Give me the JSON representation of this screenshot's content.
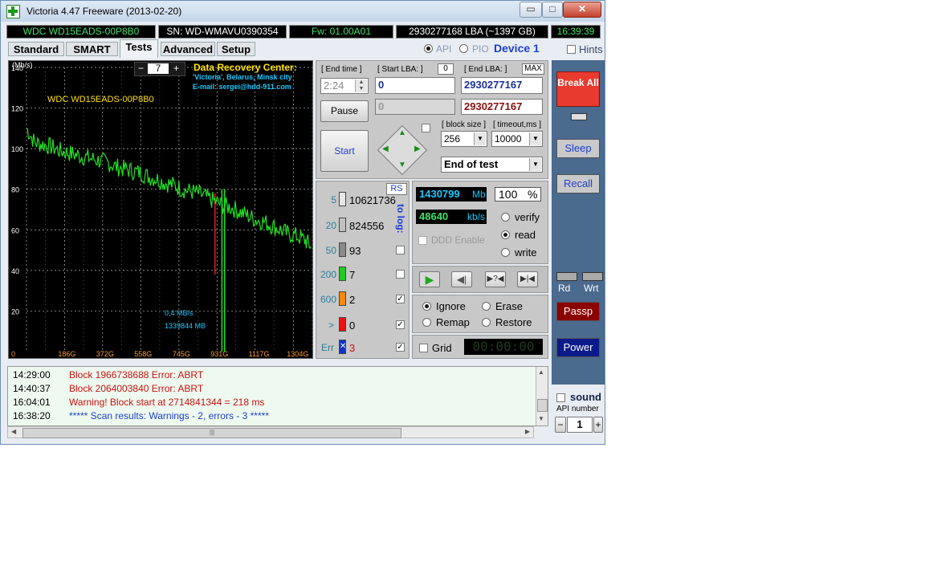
{
  "window": {
    "title": "Victoria 4.47  Freeware (2013-02-20)",
    "buttons": {
      "minimize": "▭",
      "maximize": "□",
      "close": "✕"
    }
  },
  "infobar": {
    "model": "WDC WD15EADS-00P8B0",
    "serial": "SN: WD-WMAVU0390354",
    "firmware": "Fw: 01.00A01",
    "lba": "2930277168 LBA (~1397 GB)",
    "clock": "16:39:39"
  },
  "tabs": [
    "Standard",
    "SMART",
    "Tests",
    "Advanced",
    "Setup"
  ],
  "active_tab": "Tests",
  "mode": {
    "api": "API",
    "pio": "PIO",
    "device": "Device 1",
    "hints": "Hints"
  },
  "graph": {
    "unit": "(Mb/s)",
    "zoom": "7",
    "zoom_minus": "−",
    "zoom_plus": "+",
    "drive_label": "WDC WD15EADS-00P8B0",
    "banner_title": "Data Recovery Center:",
    "banner_line1": "'Victoria', Belarus, Minsk city",
    "banner_line2": "E-mail: sergei@hdd-911.com",
    "speed_note": "0,4 MB/s",
    "position_note": "1339844 MB",
    "yticks": [
      "140",
      "120",
      "100",
      "80",
      "60",
      "40",
      "20"
    ],
    "xticks": [
      "0",
      "186G",
      "372G",
      "558G",
      "745G",
      "931G",
      "1117G",
      "1304G"
    ]
  },
  "chart_data": {
    "type": "line",
    "title": "",
    "xlabel": "",
    "ylabel": "(Mb/s)",
    "ylim": [
      0,
      140
    ],
    "xlim_gb": [
      0,
      1397
    ],
    "grid": true,
    "series": [
      {
        "x_gb": [
          0,
          40,
          80,
          120,
          160,
          200,
          240,
          280,
          320,
          360,
          400,
          440,
          480,
          520,
          560,
          600,
          640,
          680,
          720,
          760,
          800,
          840,
          880,
          920,
          960,
          1000,
          1040,
          1080,
          1120,
          1160,
          1200,
          1240,
          1280,
          1320,
          1360,
          1390
        ],
        "values": [
          110,
          103,
          102,
          101,
          99,
          98,
          97,
          96,
          95,
          94,
          93,
          91,
          90,
          89,
          88,
          86,
          85,
          83,
          82,
          80,
          79,
          78,
          76,
          74,
          72,
          71,
          69,
          67,
          65,
          64,
          62,
          60,
          58,
          57,
          55,
          52
        ]
      }
    ],
    "drop_marks_gb": [
      921,
      955,
      968
    ]
  },
  "controls": {
    "end_time_label": "[ End time ]",
    "end_time_value": "2:24",
    "start_lba_label": "[ Start LBA: ]",
    "start_lba_badge": "0",
    "start_lba_value": "0",
    "start_lba_current": "0",
    "end_lba_label": "[ End LBA: ]",
    "end_lba_max": "MAX",
    "end_lba_value": "2930277167",
    "end_lba_current": "2930277167",
    "pause": "Pause",
    "start": "Start",
    "block_size_label": "[ block size ]",
    "block_size_value": "256",
    "timeout_label": "[ timeout,ms ]",
    "timeout_value": "10000",
    "end_action": "End of test"
  },
  "blocks": {
    "rs": "RS",
    "to_log": "to log:",
    "rows": [
      {
        "label": "5",
        "count": "10621736",
        "color": "#e8e8e8"
      },
      {
        "label": "20",
        "count": "824556",
        "color": "#c0c0c0"
      },
      {
        "label": "50",
        "count": "93",
        "color": "#8a8a8a"
      },
      {
        "label": "200",
        "count": "7",
        "color": "#22cc22"
      },
      {
        "label": "600",
        "count": "2",
        "color": "#ff8800"
      },
      {
        "label": ">",
        "count": "0",
        "color": "#ee1111"
      },
      {
        "label": "Err",
        "count": "3",
        "color": "#1133cc"
      }
    ],
    "err_mark": "✕",
    "log_checks": [
      "",
      "",
      "✓",
      "✓",
      "✓"
    ]
  },
  "stats": {
    "mb_value": "1430799",
    "mb_unit": "Mb",
    "percent_value": "100",
    "percent_unit": "%",
    "speed_value": "48640",
    "speed_unit": "kb/s",
    "ddd": "DDD Enable",
    "verify": "verify",
    "read": "read",
    "write": "write"
  },
  "actions": {
    "ignore": "Ignore",
    "erase": "Erase",
    "remap": "Remap",
    "restore": "Restore",
    "grid": "Grid",
    "timer": "00:00:00"
  },
  "right": {
    "break_all": "Break All",
    "sleep": "Sleep",
    "recall": "Recall",
    "rd": "Rd",
    "wrt": "Wrt",
    "passp": "Passp",
    "power": "Power",
    "sound": "sound",
    "api_number_label": "API number",
    "api_number_value": "1",
    "minus": "−",
    "plus": "+"
  },
  "log": [
    {
      "time": "14:29:00",
      "text": "Block 1966738688 Error: ABRT",
      "color": "#cc1111"
    },
    {
      "time": "14:40:37",
      "text": "Block 2064003840 Error: ABRT",
      "color": "#cc1111"
    },
    {
      "time": "16:04:01",
      "text": "Warning! Block start at 2714841344 = 218 ms",
      "color": "#cc1111"
    },
    {
      "time": "16:38:20",
      "text": "***** Scan results: Warnings - 2, errors - 3 *****",
      "color": "#1a3fd0"
    }
  ]
}
